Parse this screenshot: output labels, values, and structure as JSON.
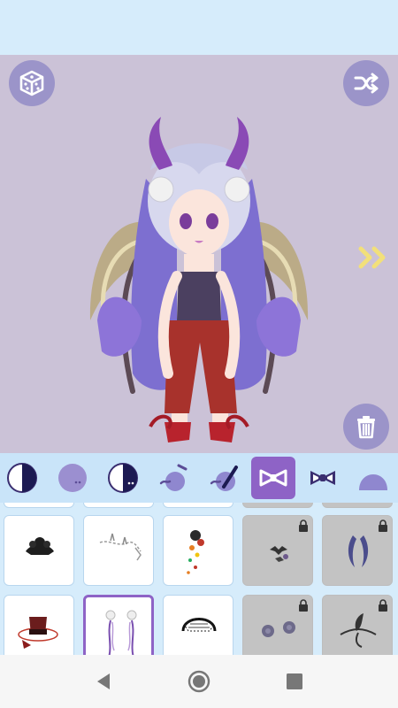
{
  "toolbar": {
    "random_icon": "dice-cube-icon",
    "shuffle_icon": "shuffle-icon",
    "trash_icon": "trash-icon",
    "next_icon": "double-chevron-right-icon"
  },
  "colors": {
    "status_bar": "#d6ecfb",
    "stage_background": "#cbc2d7",
    "button": "#9b94c9",
    "tab_strip": "#c9e4f9",
    "active_tab": "#8e63c6",
    "locked_item": "#c3c3c3"
  },
  "tabs": [
    {
      "icon": "skin-tone-icon",
      "active": false
    },
    {
      "icon": "face-icon",
      "active": false
    },
    {
      "icon": "eyes-icon",
      "active": false
    },
    {
      "icon": "mouth-icon",
      "active": false
    },
    {
      "icon": "eyebrow-icon",
      "active": false
    },
    {
      "icon": "hair-accessory-bow-icon",
      "active": true
    },
    {
      "icon": "bow-tie-icon",
      "active": false
    },
    {
      "icon": "hair-icon",
      "active": false
    }
  ],
  "items": [
    {
      "icon": "black-headpiece-icon",
      "locked": false,
      "selected": false
    },
    {
      "icon": "silver-chain-tiara-icon",
      "locked": false,
      "selected": false
    },
    {
      "icon": "flower-hairpin-icon",
      "locked": false,
      "selected": false
    },
    {
      "icon": "bat-clips-icon",
      "locked": true,
      "selected": false
    },
    {
      "icon": "purple-horns-icon",
      "locked": true,
      "selected": false
    },
    {
      "icon": "mini-top-hat-icon",
      "locked": false,
      "selected": false
    },
    {
      "icon": "rose-chain-icon",
      "locked": false,
      "selected": true
    },
    {
      "icon": "lace-headband-icon",
      "locked": false,
      "selected": false
    },
    {
      "icon": "rose-clips-icon",
      "locked": true,
      "selected": false
    },
    {
      "icon": "leaf-ornament-icon",
      "locked": true,
      "selected": false
    }
  ],
  "navbar": {
    "back_icon": "back-triangle-icon",
    "home_icon": "home-circle-icon",
    "recents_icon": "recents-square-icon"
  }
}
